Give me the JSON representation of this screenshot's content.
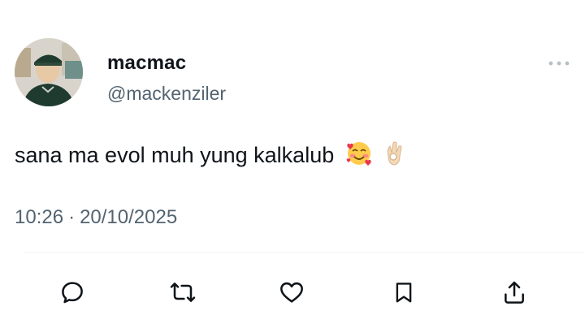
{
  "tweet": {
    "author": {
      "display_name": "macmac",
      "handle": "@mackenziler",
      "avatar": "profile-photo"
    },
    "text": "sana ma evol muh yung kalkalub",
    "emojis": [
      "smiling-face-with-hearts",
      "ok-hand-light-skin-tone"
    ],
    "time": "10:26",
    "separator": "·",
    "date": "20/10/2025"
  },
  "menu": {
    "icon": "more-dots-icon"
  },
  "actions": [
    {
      "name": "reply",
      "icon": "comment-icon"
    },
    {
      "name": "retweet",
      "icon": "retweet-icon"
    },
    {
      "name": "like",
      "icon": "heart-icon"
    },
    {
      "name": "bookmark",
      "icon": "bookmark-icon"
    },
    {
      "name": "share",
      "icon": "share-icon"
    }
  ],
  "colors": {
    "text": "#0f1419",
    "secondary": "#536471",
    "divider": "#eff3f4"
  }
}
